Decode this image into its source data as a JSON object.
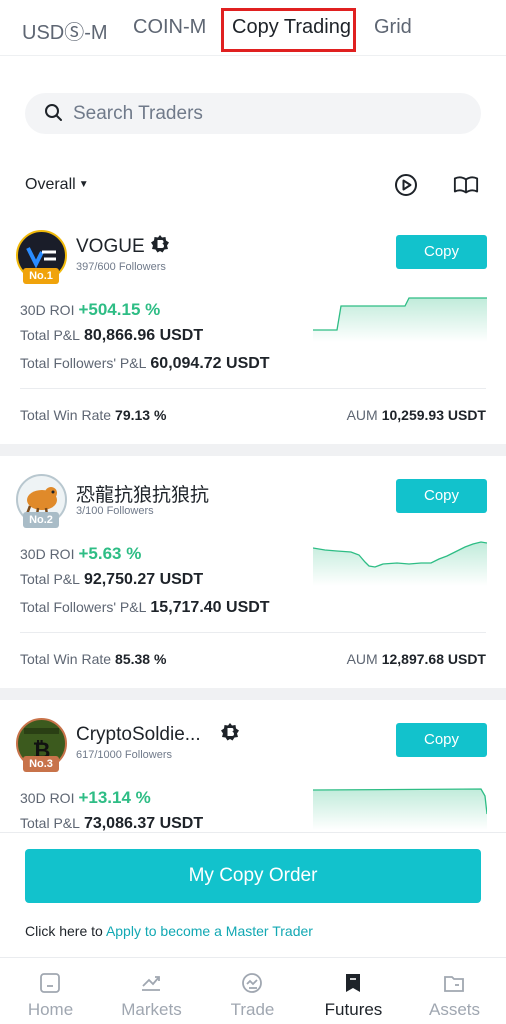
{
  "tabs": [
    {
      "label": "USDⓈ-M"
    },
    {
      "label": "COIN-M"
    },
    {
      "label": "Copy Trading"
    },
    {
      "label": "Grid"
    }
  ],
  "search": {
    "placeholder": "Search Traders"
  },
  "filter": {
    "label": "Overall"
  },
  "traders": [
    {
      "name": "VOGUE",
      "followers": "397/600 Followers",
      "rank": "No.1",
      "copy_label": "Copy",
      "roi_label": "30D ROI",
      "roi": "+504.15 %",
      "pnl_label": "Total P&L",
      "pnl": "80,866.96 USDT",
      "fpnl_label": "Total Followers' P&L",
      "fpnl": "60,094.72 USDT",
      "winrate_label": "Total Win Rate",
      "winrate": "79.13 %",
      "aum_label": "AUM",
      "aum": "10,259.93 USDT"
    },
    {
      "name": "恐龍抗狼抗狼抗",
      "followers": "3/100 Followers",
      "rank": "No.2",
      "copy_label": "Copy",
      "roi_label": "30D ROI",
      "roi": "+5.63 %",
      "pnl_label": "Total P&L",
      "pnl": "92,750.27 USDT",
      "fpnl_label": "Total Followers' P&L",
      "fpnl": "15,717.40 USDT",
      "winrate_label": "Total Win Rate",
      "winrate": "85.38 %",
      "aum_label": "AUM",
      "aum": "12,897.68 USDT"
    },
    {
      "name": "CryptoSoldie...",
      "followers": "617/1000 Followers",
      "rank": "No.3",
      "copy_label": "Copy",
      "roi_label": "30D ROI",
      "roi": "+13.14 %",
      "pnl_label": "Total P&L",
      "pnl": "73,086.37 USDT"
    }
  ],
  "bottom": {
    "my_copy_order": "My Copy Order",
    "apply_prefix": "Click here to",
    "apply_link": "Apply to become a Master Trader"
  },
  "nav": [
    {
      "label": "Home",
      "icon": "home-icon"
    },
    {
      "label": "Markets",
      "icon": "markets-icon"
    },
    {
      "label": "Trade",
      "icon": "trade-icon"
    },
    {
      "label": "Futures",
      "icon": "futures-icon"
    },
    {
      "label": "Assets",
      "icon": "assets-icon"
    }
  ],
  "colors": {
    "accent": "#12c2cc",
    "positive": "#2ebd85",
    "highlight": "#e02020"
  }
}
